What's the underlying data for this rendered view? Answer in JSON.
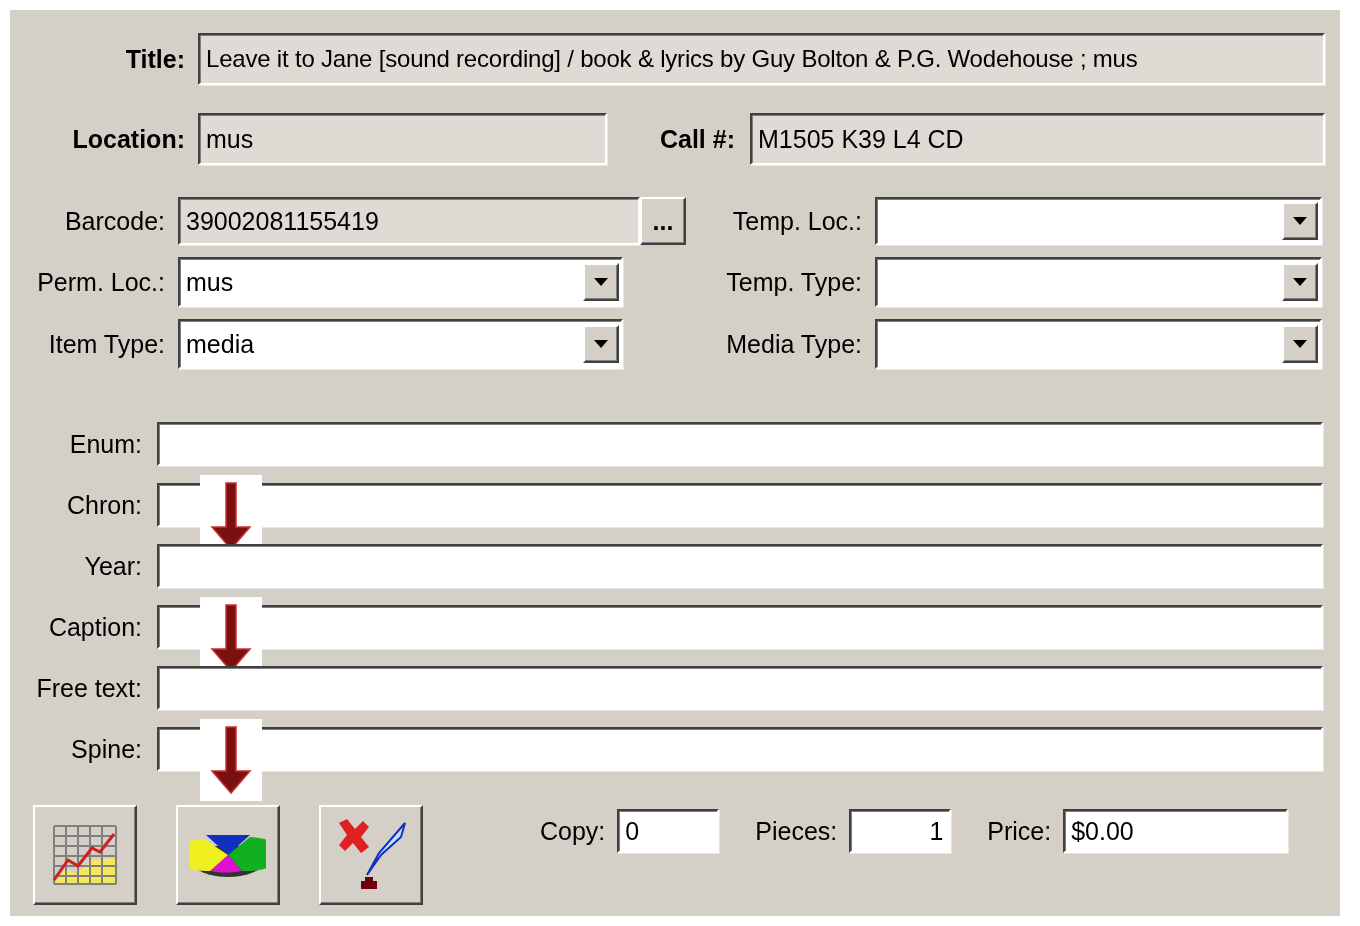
{
  "title": {
    "label": "Title:",
    "value": "Leave it to Jane [sound recording] / book & lyrics by Guy Bolton & P.G. Wodehouse ; mus"
  },
  "location": {
    "label": "Location:",
    "value": "mus"
  },
  "call_number": {
    "label": "Call #:",
    "value": "M1505 K39 L4 CD"
  },
  "barcode": {
    "label": "Barcode:",
    "value": "39002081155419",
    "button": "..."
  },
  "left_dropdowns": [
    {
      "label": "Perm. Loc.:",
      "value": "mus"
    },
    {
      "label": "Item Type:",
      "value": "media"
    }
  ],
  "right_dropdowns": [
    {
      "label": "Temp. Loc.:"
    },
    {
      "label": "Temp. Type:"
    },
    {
      "label": "Media Type:"
    }
  ],
  "text_fields": [
    {
      "label": "Enum:",
      "arrow": false
    },
    {
      "label": "Chron:",
      "arrow": true
    },
    {
      "label": "Year:",
      "arrow": false
    },
    {
      "label": "Caption:",
      "arrow": true
    },
    {
      "label": "Free text:",
      "arrow": false
    },
    {
      "label": "Spine:",
      "arrow": true
    }
  ],
  "toolbar_buttons": [
    {
      "kind": "chart"
    },
    {
      "kind": "pie"
    },
    {
      "kind": "delete"
    }
  ],
  "copy": {
    "label": "Copy:",
    "value": "0"
  },
  "pieces": {
    "label": "Pieces:",
    "value": "1"
  },
  "price": {
    "label": "Price:",
    "value": "$0.00"
  }
}
